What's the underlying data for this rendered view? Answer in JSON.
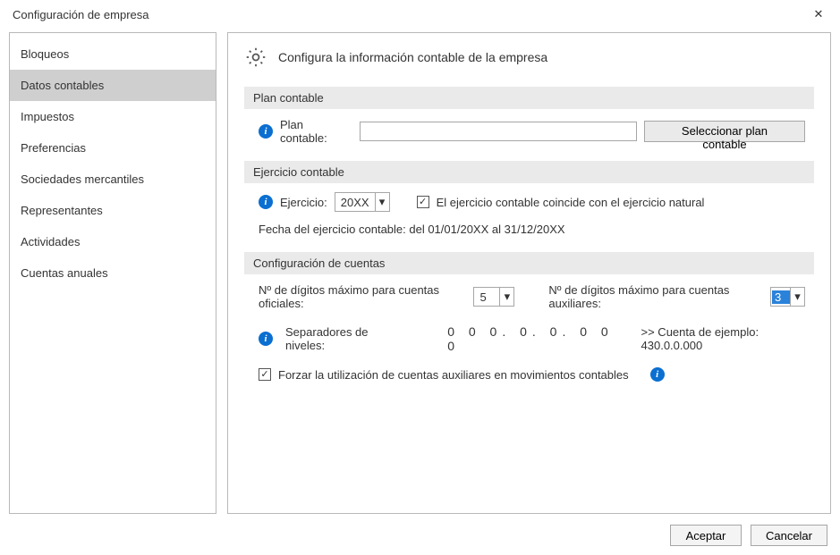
{
  "window": {
    "title": "Configuración de empresa"
  },
  "sidebar": {
    "items": {
      "0": {
        "label": "Bloqueos"
      },
      "1": {
        "label": "Datos contables"
      },
      "2": {
        "label": "Impuestos"
      },
      "3": {
        "label": "Preferencias"
      },
      "4": {
        "label": "Sociedades mercantiles"
      },
      "5": {
        "label": "Representantes"
      },
      "6": {
        "label": "Actividades"
      },
      "7": {
        "label": "Cuentas anuales"
      }
    }
  },
  "page": {
    "heading": "Configura la información contable de la empresa"
  },
  "plan": {
    "section_label": "Plan contable",
    "field_label": "Plan contable:",
    "value": "",
    "select_button": "Seleccionar plan contable"
  },
  "ejercicio": {
    "section_label": "Ejercicio contable",
    "field_label": "Ejercicio:",
    "value": "20XX",
    "checkbox_label": "El ejercicio contable coincide con el ejercicio natural",
    "checkbox_checked": "✓",
    "date_text": "Fecha del ejercicio contable: del 01/01/20XX al 31/12/20XX"
  },
  "cuentas": {
    "section_label": "Configuración de cuentas",
    "oficiales_label": "Nº de dígitos máximo para cuentas oficiales:",
    "oficiales_value": "5",
    "auxiliares_label": "Nº de dígitos máximo para cuentas auxiliares:",
    "auxiliares_value": "3",
    "separadores_label": "Separadores de niveles:",
    "separadores_sample": "0 0 0. 0. 0.  0 0 0",
    "ejemplo_label": ">> Cuenta de ejemplo: 430.0.0.000",
    "forzar_checked": "✓",
    "forzar_label": "Forzar la utilización de cuentas auxiliares en movimientos contables"
  },
  "footer": {
    "accept": "Aceptar",
    "cancel": "Cancelar"
  },
  "glyphs": {
    "close": "✕",
    "check": "✓",
    "chevron_down": "▾",
    "info": "i"
  }
}
